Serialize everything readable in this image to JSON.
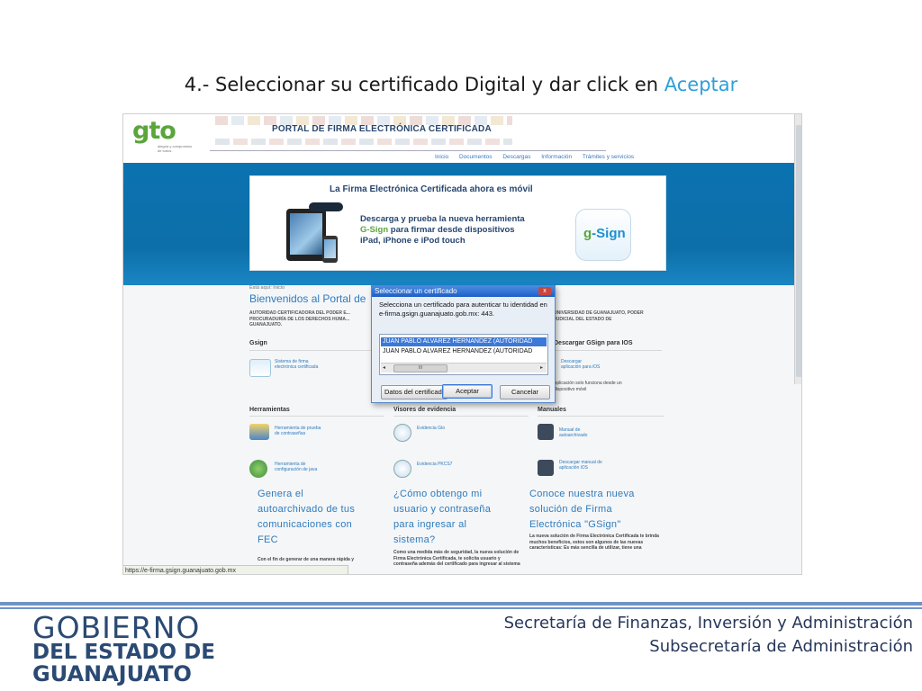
{
  "slide": {
    "title_prefix": "4.- Seleccionar su certificado Digital y dar click en ",
    "title_accent": "Aceptar"
  },
  "portal": {
    "logo": "gto",
    "logo_tagline": "alegría y compromiso de todos",
    "title": "PORTAL DE FIRMA ELECTRÓNICA CERTIFICADA",
    "nav": [
      "Inicio",
      "Documentos",
      "Descargas",
      "Información",
      "Trámites y servicios"
    ],
    "banner": {
      "title": "La Firma Electrónica Certificada ahora es móvil",
      "line1": "Descarga y prueba la nueva herramienta",
      "line2_brand": "G-Sign",
      "line2_rest": " para firmar desde dispositivos",
      "line3": "iPad, iPhone e iPod touch",
      "badge": "Sign"
    },
    "breadcrumb": "Está aquí: Inicio",
    "welcome": "Bienvenidos al Portal de",
    "intro_left": "AUTORIDAD CERTIFICADORA DEL PODER E... PROCURADURÍA DE LOS DERECHOS HUMA... GUANAJUATO.",
    "intro_right": "UNIVERSIDAD DE GUANAJUATO, PODER JUDICIAL DEL ESTADO DE",
    "sections": {
      "gsign": "Gsign",
      "gsign_item": "Sistema de firma electrónica certificada",
      "ios": "Descargar GSign para IOS",
      "ios_item": "Descargar aplicación para iOS",
      "ios_note": "Aplicación solo funciona desde un dispositivo móvil",
      "herramientas": "Herramientas",
      "herr_item1": "Herramienta de prueba de contraseñas",
      "herr_item2": "Herramienta de configuración de java",
      "visores": "Visores de evidencia",
      "vis_item1": "Evidencia Gto",
      "vis_item2": "Evidencia PKCS7",
      "manuales": "Manuales",
      "man_item1": "Manual de autoarchivado",
      "man_item2": "Descargar manual de aplicación iOS"
    },
    "teasers": {
      "col1": [
        "Genera el",
        "autoarchivado de tus",
        "comunicaciones con",
        "FEC"
      ],
      "col2": [
        "¿Cómo obtengo mi",
        "usuario y contraseña",
        "para ingresar al",
        "sistema?"
      ],
      "col3": [
        "Conoce nuestra nueva",
        "solución de Firma",
        "Electrónica \"GSign\""
      ],
      "col1_body": "Con el fin de generar de una manera rápida y",
      "col2_body": "Como una medida más de seguridad, la nueva solución de Firma Electrónica Certificada, te solicita usuario y contraseña además del certificado para ingresar al sistema",
      "col3_body": "La nueva solución de Firma Electrónica Certificada te brinda muchos beneficios, estos son algunos de las nuevas características: Es más sencilla de utilizar, tiene una"
    },
    "status_url": "https://e-firma.gsign.guanajuato.gob.mx"
  },
  "dialog": {
    "title": "Seleccionar un certificado",
    "close": "x",
    "message": "Selecciona un certificado para autenticar tu identidad en e-firma.gsign.guanajuato.gob.mx: 443.",
    "certificates": [
      "JUAN PABLO ALVAREZ HERNANDEZ (AUTORIDAD",
      "JUAN PABLO ALVAREZ HERNANDEZ (AUTORIDAD"
    ],
    "scroll_left": "◂",
    "scroll_thumb": "III",
    "scroll_right": "▸",
    "btn_datos": "Datos del certificado",
    "btn_aceptar": "Aceptar",
    "btn_cancelar": "Cancelar"
  },
  "footer": {
    "logo_line1": "GOBIERNO",
    "logo_line2": "DEL ESTADO DE",
    "logo_line3": "GUANAJUATO",
    "right_line1": "Secretaría de Finanzas, Inversión y Administración",
    "right_line2": "Subsecretaría de Administración"
  },
  "colors": {
    "accent": "#2f9fd8",
    "portal_blue": "#0d6fa8",
    "footer_navy": "#2b4a73",
    "selection": "#3b78d8"
  }
}
